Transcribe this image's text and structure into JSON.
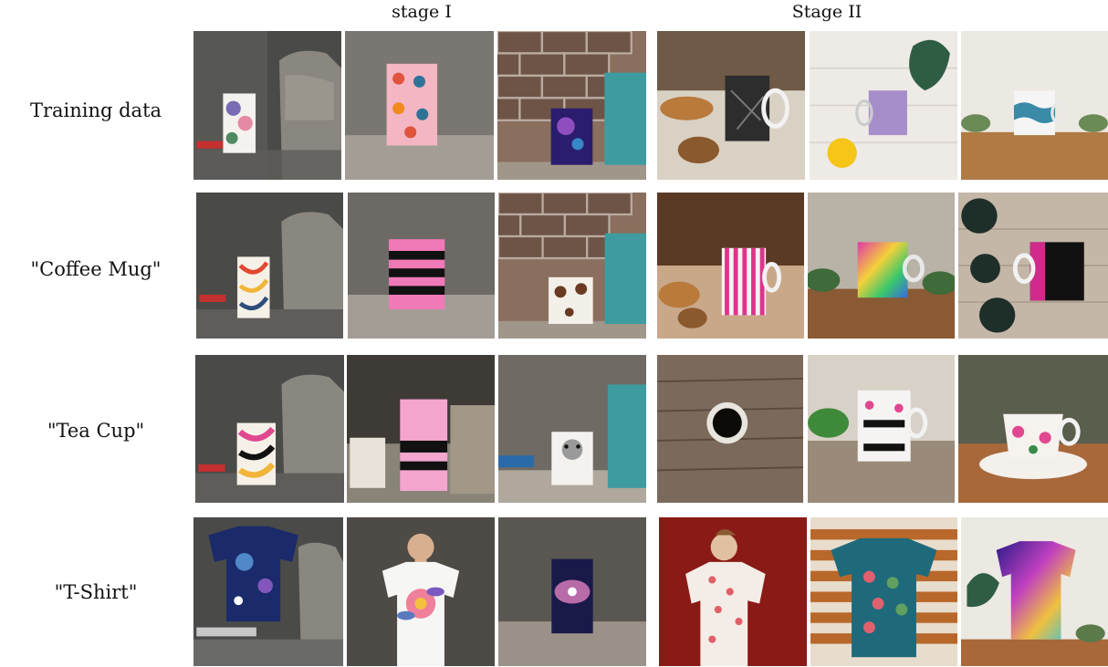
{
  "columns": {
    "stage1": "stage I",
    "stage2": "Stage II"
  },
  "rows": [
    {
      "label": "Training data"
    },
    {
      "label": "\"Coffee Mug\""
    },
    {
      "label": "\"Tea Cup\""
    },
    {
      "label": "\"T-Shirt\""
    }
  ],
  "image_descriptions": [
    [
      "mug-floral-armchair",
      "mug-pink-leaves-corner",
      "mug-galaxy-brick",
      "mug-marble-croissants",
      "mug-purple-monstera-lemon",
      "mug-blue-waves-shelf"
    ],
    [
      "mug-abstract-stripes-armchair",
      "mug-pink-black-stripes-corner",
      "mug-cat-brick",
      "mug-vertical-stripes-pastries",
      "mug-rainbow-ferns",
      "mug-pink-black-monstera"
    ],
    [
      "cup-abstract-armchair",
      "cup-pink-sleeve-books",
      "cup-cat-shelf",
      "cup-black-coffee-topdown",
      "cup-floral-dogs",
      "cup-floral-saucer"
    ],
    [
      "tshirt-galaxy-hanger",
      "tshirt-floral-man",
      "tshirt-galaxy-box",
      "tshirt-floral-model-red",
      "tshirt-teal-flowers-hanger",
      "tshirt-galaxy-rainbow-hanger"
    ]
  ]
}
